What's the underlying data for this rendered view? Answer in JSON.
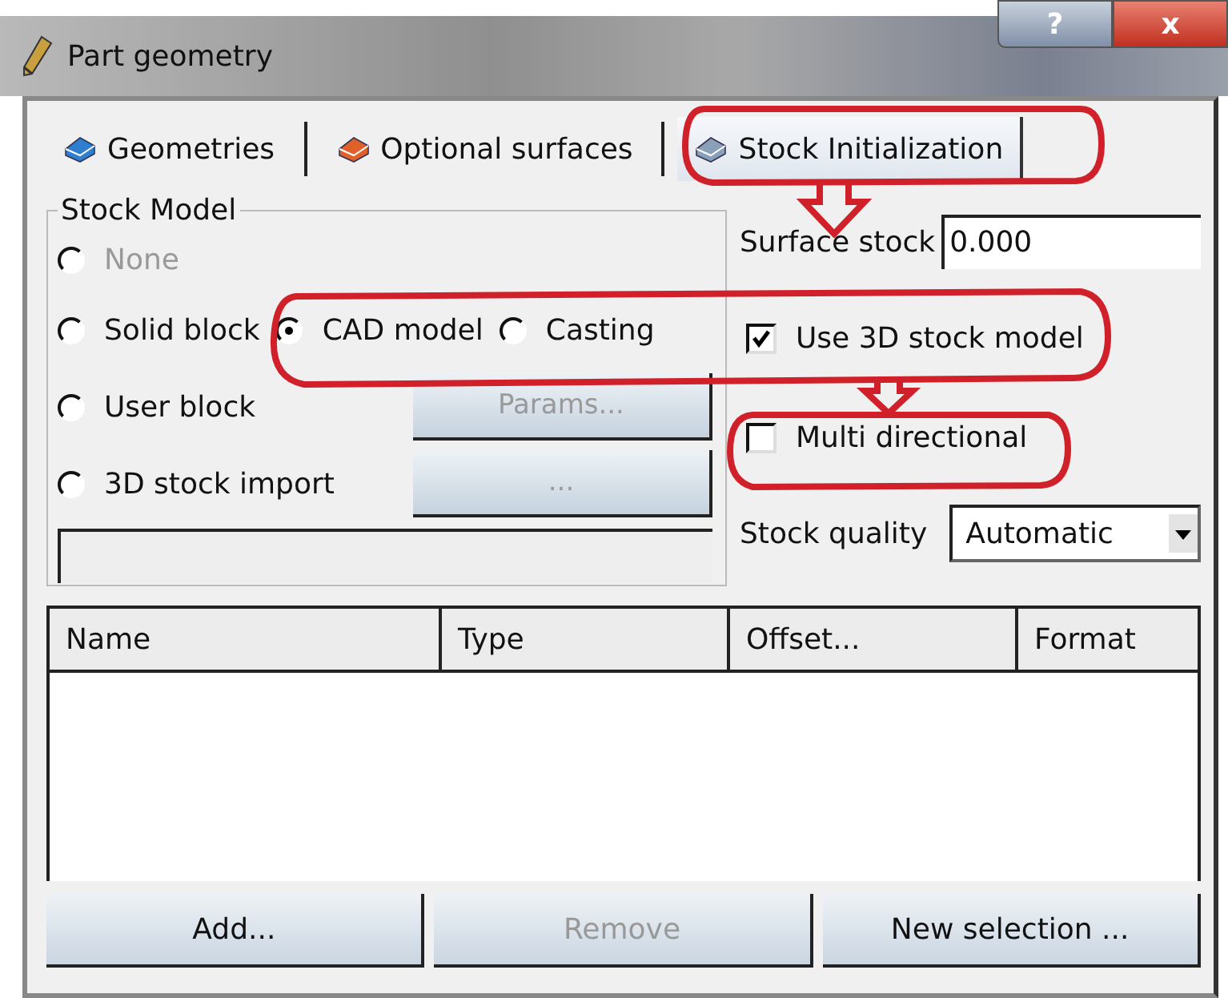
{
  "window": {
    "title": "Part geometry",
    "help_button": "?",
    "close_button": "x"
  },
  "tabs": [
    {
      "label": "Geometries",
      "selected": false
    },
    {
      "label": "Optional surfaces",
      "selected": false
    },
    {
      "label": "Stock Initialization",
      "selected": true
    }
  ],
  "stock_model": {
    "title": "Stock Model",
    "rows": [
      {
        "options": [
          {
            "label": "None",
            "selected": false,
            "disabled": true
          }
        ]
      },
      {
        "options": [
          {
            "label": "Solid block",
            "selected": false,
            "disabled": false
          },
          {
            "label": "CAD model",
            "selected": true,
            "disabled": false
          },
          {
            "label": "Casting",
            "selected": false,
            "disabled": false
          }
        ]
      },
      {
        "options": [
          {
            "label": "User block",
            "selected": false,
            "disabled": false
          }
        ],
        "button": {
          "label": "Params...",
          "disabled": true
        }
      },
      {
        "options": [
          {
            "label": "3D stock import",
            "selected": false,
            "disabled": false
          }
        ],
        "button": {
          "label": "...",
          "disabled": true
        }
      }
    ]
  },
  "surface_stock": {
    "label": "Surface stock",
    "value": "0.000"
  },
  "checkboxes": [
    {
      "label": "Use 3D stock model",
      "checked": true
    },
    {
      "label": "Multi directional",
      "checked": false
    }
  ],
  "stock_quality": {
    "label": "Stock quality",
    "value": "Automatic"
  },
  "table": {
    "columns": [
      "Name",
      "Type",
      "Offset...",
      "Format"
    ]
  },
  "buttons": [
    {
      "label": "Add...",
      "disabled": false
    },
    {
      "label": "Remove",
      "disabled": true
    },
    {
      "label": "New selection ...",
      "disabled": false
    }
  ]
}
